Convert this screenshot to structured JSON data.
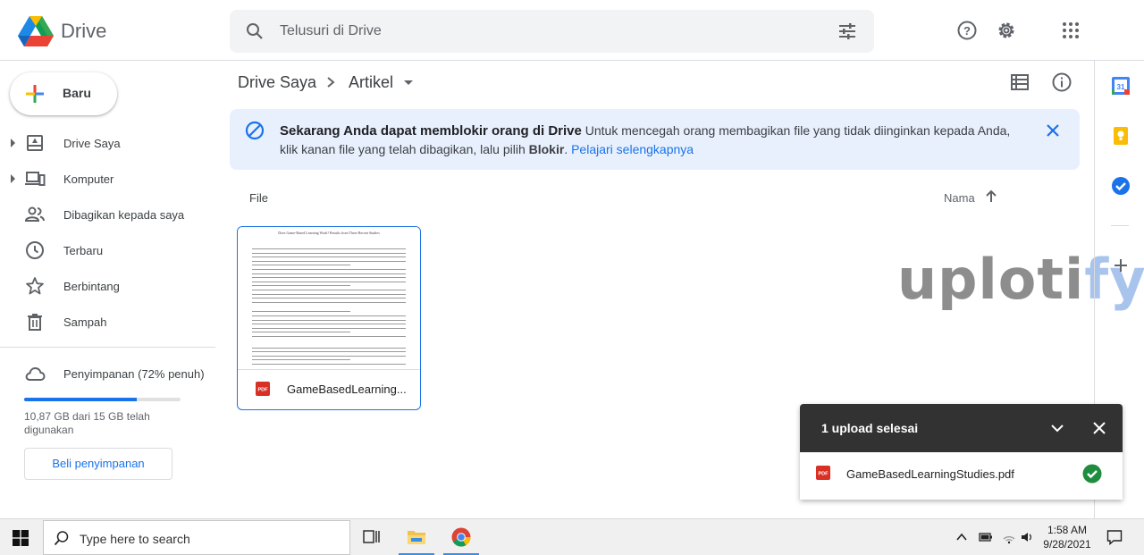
{
  "header": {
    "app_name": "Drive",
    "search_placeholder": "Telusuri di Drive"
  },
  "sidebar": {
    "new_button": "Baru",
    "items": [
      {
        "label": "Drive Saya",
        "icon": "my-drive-icon"
      },
      {
        "label": "Komputer",
        "icon": "computer-icon"
      },
      {
        "label": "Dibagikan kepada saya",
        "icon": "shared-icon"
      },
      {
        "label": "Terbaru",
        "icon": "clock-icon"
      },
      {
        "label": "Berbintang",
        "icon": "star-icon"
      },
      {
        "label": "Sampah",
        "icon": "trash-icon"
      }
    ],
    "storage": {
      "label": "Penyimpanan (72% penuh)",
      "percent_used": 72,
      "usage_text": "10,87 GB dari 15 GB telah digunakan",
      "buy_button": "Beli penyimpanan"
    }
  },
  "main": {
    "breadcrumb": {
      "root": "Drive Saya",
      "current": "Artikel"
    },
    "banner": {
      "title": "Sekarang Anda dapat memblokir orang di Drive",
      "text": " Untuk mencegah orang membagikan file yang tidak diinginkan kepada Anda, klik kanan file yang telah dibagikan, lalu pilih ",
      "bold": "Blokir",
      "period": ". ",
      "link": "Pelajari selengkapnya"
    },
    "section_label": "File",
    "sort_label": "Nama",
    "files": [
      {
        "name": "GameBasedLearningStudies.pdf",
        "display_name": "GameBasedLearning...",
        "thumb_title": "Does Game-Based Learning Work? Results from Three Recent Studies"
      }
    ]
  },
  "watermark": {
    "part1": "uploti",
    "part2": "fy"
  },
  "upload_panel": {
    "title": "1 upload selesai",
    "file": "GameBasedLearningStudies.pdf",
    "status": "complete"
  },
  "taskbar": {
    "search_placeholder": "Type here to search",
    "time": "1:58 AM",
    "date": "9/28/2021"
  },
  "colors": {
    "accent": "#1a73e8",
    "banner_bg": "#e8f0fe",
    "upload_header": "#323232",
    "success": "#1e8e3e",
    "pdf": "#d93025"
  }
}
